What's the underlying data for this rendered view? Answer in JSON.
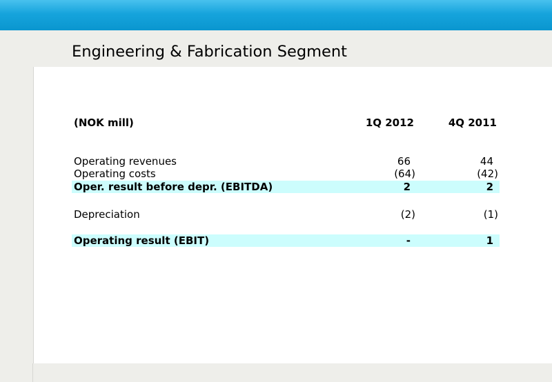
{
  "slide": {
    "title": "Engineering & Fabrication Segment"
  },
  "table": {
    "header": {
      "label": "(NOK mill)",
      "col1": "1Q 2012",
      "col2": "4Q 2011"
    },
    "revenues": {
      "label": "Operating revenues",
      "col1": "66",
      "col2": "44"
    },
    "costs": {
      "label": "Operating costs",
      "col1": "(64)",
      "col2": "(42)"
    },
    "ebitda": {
      "label": "Oper. result before depr. (EBITDA)",
      "col1": "2",
      "col2": "2"
    },
    "depreciation": {
      "label": "Depreciation",
      "col1": "(2)",
      "col2": "(1)"
    },
    "ebit": {
      "label": "Operating result (EBIT)",
      "col1": "-",
      "col2": "1"
    }
  },
  "colors": {
    "header_bar": "#16a4dc",
    "band": "#eeeeea",
    "highlight_row": "#ccfdfd"
  }
}
